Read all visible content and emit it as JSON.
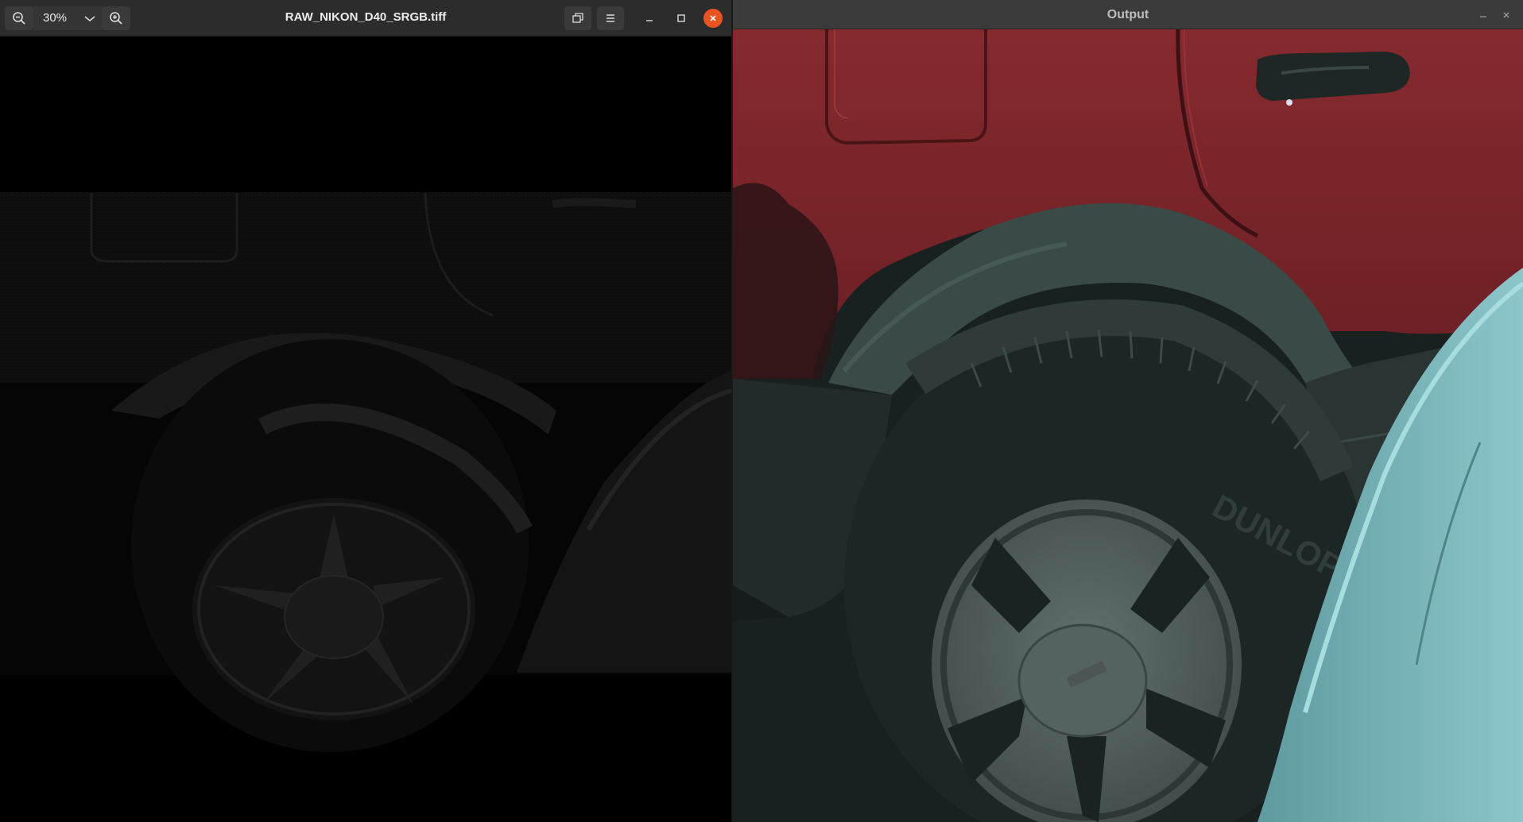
{
  "viewer": {
    "title": "RAW_NIKON_D40_SRGB.tiff",
    "zoom": "30%",
    "icons": {
      "zoom_out": "zoom-out-icon",
      "zoom_in": "zoom-in-icon",
      "dropdown": "chevron-down-icon",
      "restore": "restore-window-icon",
      "menu": "hamburger-menu-icon",
      "minimize": "minimize-icon",
      "maximize": "maximize-icon",
      "close": "close-icon"
    },
    "close_color": "#e95420",
    "image_tone": "very dark raw image"
  },
  "output": {
    "title": "Output",
    "icons": {
      "minimize": "minimize-icon",
      "close": "close-icon"
    },
    "colors": {
      "car_red": "#7a2529",
      "fender_gray": "#3a4b48",
      "tire": "#1f2b2a",
      "wheel": "#4e5a58",
      "blue_car": "#7bb8bd"
    }
  }
}
